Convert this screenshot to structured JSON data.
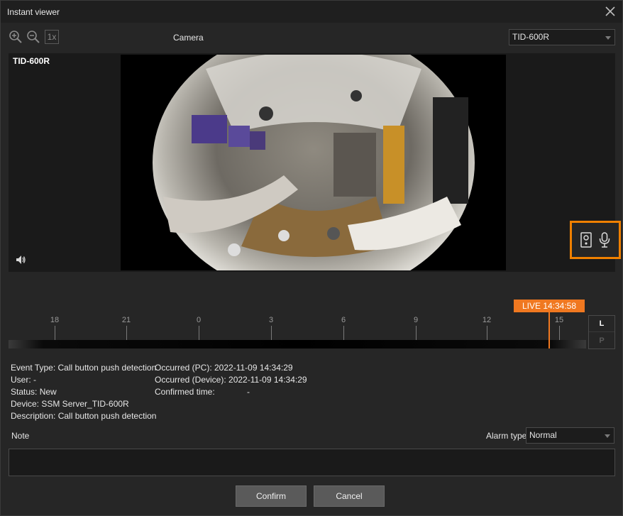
{
  "window": {
    "title": "Instant viewer"
  },
  "toolbar": {
    "zoom_in_icon": "zoom-in-icon",
    "zoom_out_icon": "zoom-out-icon",
    "zoom_1x_label": "1x"
  },
  "camera": {
    "label": "Camera",
    "selected": "TID-600R",
    "overlay_name": "TID-600R"
  },
  "timeline": {
    "ticks": [
      "18",
      "21",
      "0",
      "3",
      "6",
      "9",
      "12",
      "15"
    ],
    "live_label": "LIVE 14:34:58",
    "mode_buttons": [
      "L",
      "P"
    ]
  },
  "event_info": {
    "left": [
      "Event Type: Call button push detection",
      "User: -",
      "Status: New",
      "Device: SSM Server_TID-600R",
      "Description: Call button push detection"
    ],
    "occurred_pc": "Occurred (PC): 2022-11-09 14:34:29",
    "occurred_device": "Occurred (Device): 2022-11-09 14:34:29",
    "confirmed_label": "Confirmed time:",
    "confirmed_value": "-"
  },
  "note": {
    "label": "Note",
    "value": ""
  },
  "alarm": {
    "label": "Alarm type",
    "selected": "Normal"
  },
  "buttons": {
    "confirm": "Confirm",
    "cancel": "Cancel"
  },
  "colors": {
    "accent": "#f07820",
    "highlight_border": "#f08000",
    "background": "#262626"
  }
}
